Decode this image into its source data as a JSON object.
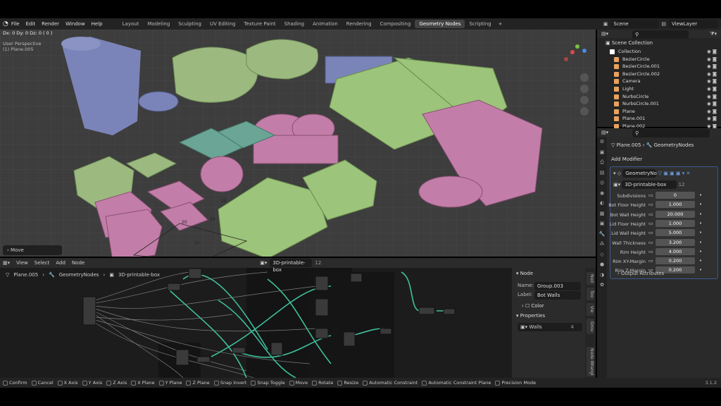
{
  "menu": [
    "File",
    "Edit",
    "Render",
    "Window",
    "Help"
  ],
  "workspaces": [
    {
      "label": "Layout"
    },
    {
      "label": "Modeling"
    },
    {
      "label": "Sculpting"
    },
    {
      "label": "UV Editing"
    },
    {
      "label": "Texture Paint"
    },
    {
      "label": "Shading"
    },
    {
      "label": "Animation"
    },
    {
      "label": "Rendering"
    },
    {
      "label": "Compositing"
    },
    {
      "label": "Geometry Nodes",
      "active": true
    },
    {
      "label": "Scripting"
    }
  ],
  "add_tab": "+",
  "scene": "Scene",
  "viewlayer": "ViewLayer",
  "viewport": {
    "delta": "Dx: 0   Dy: 0   Dz: 0  ( 0 )",
    "view_name": "User Perspective",
    "object": "(1) Plane.005",
    "last_op": "Move",
    "dims": [
      "20",
      "20",
      "20",
      "37"
    ]
  },
  "node_editor": {
    "menu": [
      "View",
      "Select",
      "Add",
      "Node"
    ],
    "tree_name": "3D-printable-box",
    "users": "12",
    "crumbs": [
      "Plane.005",
      "GeometryNodes",
      "3D-printable-box"
    ],
    "panel": {
      "section": "Node",
      "name_label": "Name:",
      "name_value": "Group.003",
      "label_label": "Label:",
      "label_value": "Bot Walls",
      "color": "Color",
      "properties": "Properties",
      "walls": "Walls",
      "walls_users": "4"
    },
    "tabs": [
      "Nod",
      "Too",
      "Vie",
      "Grou",
      "Node Wrangl"
    ]
  },
  "outliner": {
    "header": "Scene Collection",
    "items": [
      {
        "label": "Collection",
        "color": "#ffffff"
      },
      {
        "label": "BezierCircle",
        "color": "#e8a25d"
      },
      {
        "label": "BezierCircle.001",
        "color": "#e8a25d"
      },
      {
        "label": "BezierCircle.002",
        "color": "#e8a25d"
      },
      {
        "label": "Camera",
        "color": "#e8a25d"
      },
      {
        "label": "Light",
        "color": "#e8a25d"
      },
      {
        "label": "NurbsCircle",
        "color": "#e8a25d"
      },
      {
        "label": "NurbsCircle.001",
        "color": "#e8a25d"
      },
      {
        "label": "Plane",
        "color": "#e8a25d"
      },
      {
        "label": "Plane.001",
        "color": "#e8a25d"
      },
      {
        "label": "Plane.002",
        "color": "#e8a25d"
      }
    ]
  },
  "properties": {
    "object": "Plane.005",
    "modifier_name": "GeometryNodes",
    "add_modifier": "Add Modifier",
    "mod_short": "GeometryNo",
    "tree_name": "3D-printable-box",
    "users": "12",
    "output": "Output Attributes",
    "fields": [
      {
        "label": "Subdivisions",
        "value": "0"
      },
      {
        "label": "Bot Floor Height",
        "value": "1.000"
      },
      {
        "label": "Bot Wall Height",
        "value": "20.000"
      },
      {
        "label": "Lid Floor Height",
        "value": "1.000"
      },
      {
        "label": "Lid Wall Height",
        "value": "5.000"
      },
      {
        "label": "Wall Thickness",
        "value": "3.200"
      },
      {
        "label": "Rim Height",
        "value": "4.000"
      },
      {
        "label": "Rim XY-Margin",
        "value": "0.200"
      },
      {
        "label": "Rim Z-Margin",
        "value": "0.200"
      }
    ]
  },
  "status": [
    "Confirm",
    "Cancel",
    "X Axis",
    "Y Axis",
    "Z Axis",
    "X Plane",
    "Y Plane",
    "Z Plane",
    "Snap Invert",
    "Snap Toggle",
    "Move",
    "Rotate",
    "Resize",
    "Automatic Constraint",
    "Automatic Constraint Plane",
    "Precision Mode"
  ],
  "version": "3.1.2",
  "colors": {
    "green": "#9cc47a",
    "pink": "#c27ea8",
    "teal": "#6aa596",
    "blue": "#7b84b8",
    "lightgreen": "#9cba7f",
    "wire": "#3fbf9c"
  }
}
